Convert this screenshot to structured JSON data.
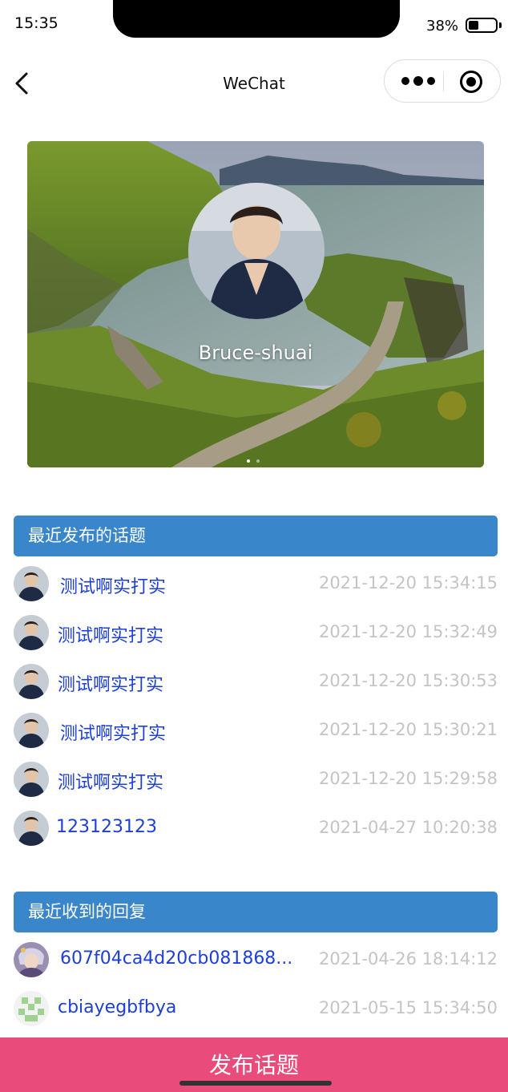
{
  "status_bar": {
    "time": "15:35",
    "battery": "38%"
  },
  "nav": {
    "title": "WeChat",
    "more_icon": "more-dots-icon",
    "close_icon": "record-close-icon"
  },
  "banner": {
    "name": "Bruce-shuai",
    "image": "coastal-cliff-staircase-photo",
    "avatar": "user-portrait-photo"
  },
  "recent_topics": {
    "title": "最近发布的话题",
    "items": [
      {
        "title": "测试啊实打实",
        "time": "2021-12-20 15:34:15"
      },
      {
        "title": "测试啊实打实",
        "time": "2021-12-20 15:32:49"
      },
      {
        "title": "测试啊实打实",
        "time": "2021-12-20 15:30:53"
      },
      {
        "title": "测试啊实打实",
        "time": "2021-12-20 15:30:21"
      },
      {
        "title": "测试啊实打实",
        "time": "2021-12-20 15:29:58"
      },
      {
        "title": "123123123",
        "time": "2021-04-27 10:20:38"
      }
    ]
  },
  "recent_replies": {
    "title": "最近收到的回复",
    "items": [
      {
        "title": "607f04ca4d20cb081868...",
        "time": "2021-04-26 18:14:12"
      },
      {
        "title": "cbiayegbfbya",
        "time": "2021-05-15 15:34:50"
      }
    ]
  },
  "publish_button": {
    "label": "发布话题"
  },
  "colors": {
    "section_header": "#3a86cb",
    "link": "#1d3fd6",
    "time": "#c4c4c4",
    "publish": "#e94b7a"
  }
}
